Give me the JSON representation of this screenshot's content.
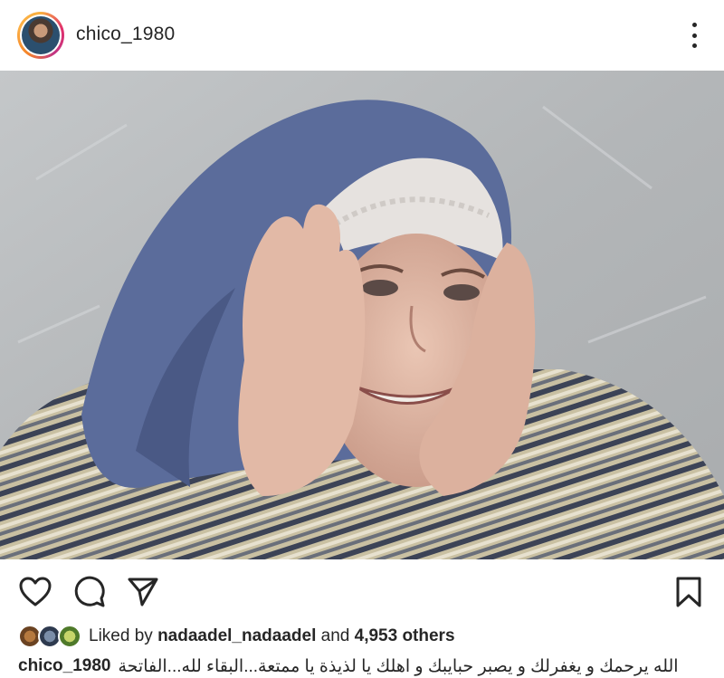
{
  "post": {
    "username": "chico_1980"
  },
  "likes": {
    "prefix": "Liked by",
    "top_liker": "nadaadel_nadaadel",
    "and_word": "and",
    "count": "4,953 others"
  },
  "caption": {
    "username": "chico_1980",
    "text": "الله يرحمك و يغفرلك و يصبر حبايبك و اهلك يا لذيذة يا ممتعة...البقاء لله...الفاتحة"
  },
  "icons": {
    "more": "more-vertical-icon",
    "like": "heart-icon",
    "comment": "comment-icon",
    "share": "send-icon",
    "save": "bookmark-icon"
  },
  "colors": {
    "text": "#262626",
    "story_ring": "#e1306c"
  }
}
